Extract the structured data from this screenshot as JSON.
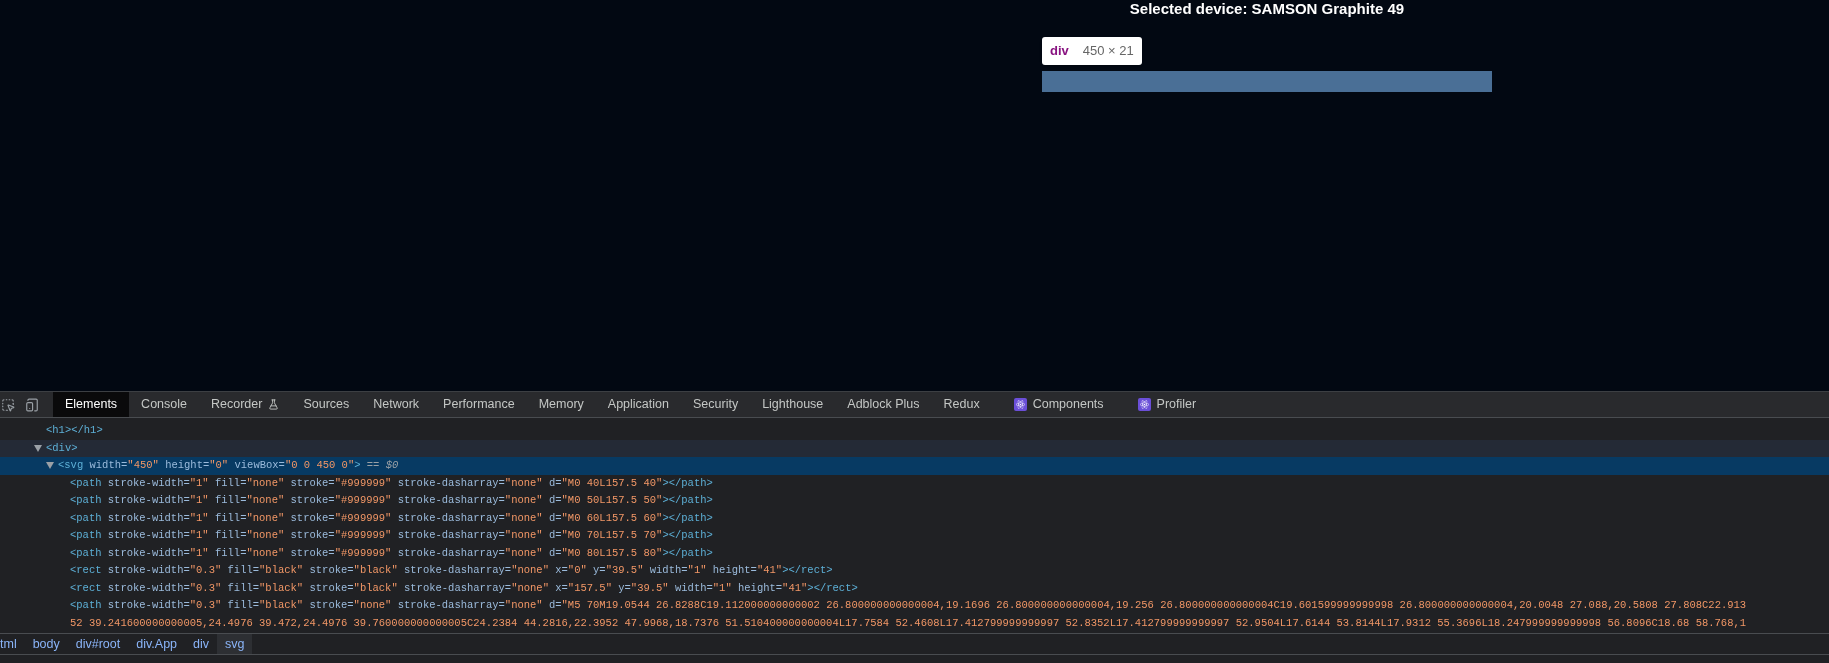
{
  "page": {
    "heading": "Selected device: SAMSON Graphite 49",
    "tooltip": {
      "tag": "div",
      "size": "450 × 21"
    }
  },
  "devtools": {
    "tabs": [
      {
        "label": "Elements",
        "selected": true
      },
      {
        "label": "Console",
        "selected": false
      },
      {
        "label": "Recorder",
        "selected": false,
        "kind": "flask"
      },
      {
        "label": "Sources",
        "selected": false
      },
      {
        "label": "Network",
        "selected": false
      },
      {
        "label": "Performance",
        "selected": false
      },
      {
        "label": "Memory",
        "selected": false
      },
      {
        "label": "Application",
        "selected": false
      },
      {
        "label": "Security",
        "selected": false
      },
      {
        "label": "Lighthouse",
        "selected": false
      },
      {
        "label": "Adblock Plus",
        "selected": false
      },
      {
        "label": "Redux",
        "selected": false
      },
      {
        "label": "Components",
        "selected": false,
        "kind": "react"
      },
      {
        "label": "Profiler",
        "selected": false,
        "kind": "react"
      }
    ],
    "dom_tree": [
      {
        "selected": false,
        "tokens": [
          {
            "kind": "tag",
            "text": "<h1></h1>"
          }
        ]
      },
      {
        "selected": false,
        "hovered": true,
        "expanded": true,
        "tokens": [
          {
            "kind": "tag",
            "text": "<div>"
          }
        ],
        "children": [
          {
            "selected": true,
            "expanded": true,
            "tokens": [
              {
                "kind": "tag",
                "text": "<svg"
              },
              {
                "kind": "attr",
                "text": " width="
              },
              {
                "kind": "value",
                "text": "\"450\""
              },
              {
                "kind": "attr",
                "text": " height="
              },
              {
                "kind": "value",
                "text": "\"0\""
              },
              {
                "kind": "attr",
                "text": " viewBox="
              },
              {
                "kind": "value",
                "text": "\"0 0 450 0\""
              },
              {
                "kind": "tag",
                "text": ">"
              },
              {
                "kind": "ref",
                "text": " == $0"
              }
            ],
            "children": [
              {
                "selected": false,
                "tokens": [
                  {
                    "kind": "tag",
                    "text": "<path"
                  },
                  {
                    "kind": "attr",
                    "text": " stroke-width="
                  },
                  {
                    "kind": "value",
                    "text": "\"1\""
                  },
                  {
                    "kind": "attr",
                    "text": " fill="
                  },
                  {
                    "kind": "value",
                    "text": "\"none\""
                  },
                  {
                    "kind": "attr",
                    "text": " stroke="
                  },
                  {
                    "kind": "value",
                    "text": "\"#999999\""
                  },
                  {
                    "kind": "attr",
                    "text": " stroke-dasharray="
                  },
                  {
                    "kind": "value",
                    "text": "\"none\""
                  },
                  {
                    "kind": "attr",
                    "text": " d="
                  },
                  {
                    "kind": "value",
                    "text": "\"M0 40L157.5 40\""
                  },
                  {
                    "kind": "tag",
                    "text": "></path>"
                  }
                ]
              },
              {
                "selected": false,
                "tokens": [
                  {
                    "kind": "tag",
                    "text": "<path"
                  },
                  {
                    "kind": "attr",
                    "text": " stroke-width="
                  },
                  {
                    "kind": "value",
                    "text": "\"1\""
                  },
                  {
                    "kind": "attr",
                    "text": " fill="
                  },
                  {
                    "kind": "value",
                    "text": "\"none\""
                  },
                  {
                    "kind": "attr",
                    "text": " stroke="
                  },
                  {
                    "kind": "value",
                    "text": "\"#999999\""
                  },
                  {
                    "kind": "attr",
                    "text": " stroke-dasharray="
                  },
                  {
                    "kind": "value",
                    "text": "\"none\""
                  },
                  {
                    "kind": "attr",
                    "text": " d="
                  },
                  {
                    "kind": "value",
                    "text": "\"M0 50L157.5 50\""
                  },
                  {
                    "kind": "tag",
                    "text": "></path>"
                  }
                ]
              },
              {
                "selected": false,
                "tokens": [
                  {
                    "kind": "tag",
                    "text": "<path"
                  },
                  {
                    "kind": "attr",
                    "text": " stroke-width="
                  },
                  {
                    "kind": "value",
                    "text": "\"1\""
                  },
                  {
                    "kind": "attr",
                    "text": " fill="
                  },
                  {
                    "kind": "value",
                    "text": "\"none\""
                  },
                  {
                    "kind": "attr",
                    "text": " stroke="
                  },
                  {
                    "kind": "value",
                    "text": "\"#999999\""
                  },
                  {
                    "kind": "attr",
                    "text": " stroke-dasharray="
                  },
                  {
                    "kind": "value",
                    "text": "\"none\""
                  },
                  {
                    "kind": "attr",
                    "text": " d="
                  },
                  {
                    "kind": "value",
                    "text": "\"M0 60L157.5 60\""
                  },
                  {
                    "kind": "tag",
                    "text": "></path>"
                  }
                ]
              },
              {
                "selected": false,
                "tokens": [
                  {
                    "kind": "tag",
                    "text": "<path"
                  },
                  {
                    "kind": "attr",
                    "text": " stroke-width="
                  },
                  {
                    "kind": "value",
                    "text": "\"1\""
                  },
                  {
                    "kind": "attr",
                    "text": " fill="
                  },
                  {
                    "kind": "value",
                    "text": "\"none\""
                  },
                  {
                    "kind": "attr",
                    "text": " stroke="
                  },
                  {
                    "kind": "value",
                    "text": "\"#999999\""
                  },
                  {
                    "kind": "attr",
                    "text": " stroke-dasharray="
                  },
                  {
                    "kind": "value",
                    "text": "\"none\""
                  },
                  {
                    "kind": "attr",
                    "text": " d="
                  },
                  {
                    "kind": "value",
                    "text": "\"M0 70L157.5 70\""
                  },
                  {
                    "kind": "tag",
                    "text": "></path>"
                  }
                ]
              },
              {
                "selected": false,
                "tokens": [
                  {
                    "kind": "tag",
                    "text": "<path"
                  },
                  {
                    "kind": "attr",
                    "text": " stroke-width="
                  },
                  {
                    "kind": "value",
                    "text": "\"1\""
                  },
                  {
                    "kind": "attr",
                    "text": " fill="
                  },
                  {
                    "kind": "value",
                    "text": "\"none\""
                  },
                  {
                    "kind": "attr",
                    "text": " stroke="
                  },
                  {
                    "kind": "value",
                    "text": "\"#999999\""
                  },
                  {
                    "kind": "attr",
                    "text": " stroke-dasharray="
                  },
                  {
                    "kind": "value",
                    "text": "\"none\""
                  },
                  {
                    "kind": "attr",
                    "text": " d="
                  },
                  {
                    "kind": "value",
                    "text": "\"M0 80L157.5 80\""
                  },
                  {
                    "kind": "tag",
                    "text": "></path>"
                  }
                ]
              },
              {
                "selected": false,
                "tokens": [
                  {
                    "kind": "tag",
                    "text": "<rect"
                  },
                  {
                    "kind": "attr",
                    "text": " stroke-width="
                  },
                  {
                    "kind": "value",
                    "text": "\"0.3\""
                  },
                  {
                    "kind": "attr",
                    "text": " fill="
                  },
                  {
                    "kind": "value",
                    "text": "\"black\""
                  },
                  {
                    "kind": "attr",
                    "text": " stroke="
                  },
                  {
                    "kind": "value",
                    "text": "\"black\""
                  },
                  {
                    "kind": "attr",
                    "text": " stroke-dasharray="
                  },
                  {
                    "kind": "value",
                    "text": "\"none\""
                  },
                  {
                    "kind": "attr",
                    "text": " x="
                  },
                  {
                    "kind": "value",
                    "text": "\"0\""
                  },
                  {
                    "kind": "attr",
                    "text": " y="
                  },
                  {
                    "kind": "value",
                    "text": "\"39.5\""
                  },
                  {
                    "kind": "attr",
                    "text": " width="
                  },
                  {
                    "kind": "value",
                    "text": "\"1\""
                  },
                  {
                    "kind": "attr",
                    "text": " height="
                  },
                  {
                    "kind": "value",
                    "text": "\"41\""
                  },
                  {
                    "kind": "tag",
                    "text": "></rect>"
                  }
                ]
              },
              {
                "selected": false,
                "tokens": [
                  {
                    "kind": "tag",
                    "text": "<rect"
                  },
                  {
                    "kind": "attr",
                    "text": " stroke-width="
                  },
                  {
                    "kind": "value",
                    "text": "\"0.3\""
                  },
                  {
                    "kind": "attr",
                    "text": " fill="
                  },
                  {
                    "kind": "value",
                    "text": "\"black\""
                  },
                  {
                    "kind": "attr",
                    "text": " stroke="
                  },
                  {
                    "kind": "value",
                    "text": "\"black\""
                  },
                  {
                    "kind": "attr",
                    "text": " stroke-dasharray="
                  },
                  {
                    "kind": "value",
                    "text": "\"none\""
                  },
                  {
                    "kind": "attr",
                    "text": " x="
                  },
                  {
                    "kind": "value",
                    "text": "\"157.5\""
                  },
                  {
                    "kind": "attr",
                    "text": " y="
                  },
                  {
                    "kind": "value",
                    "text": "\"39.5\""
                  },
                  {
                    "kind": "attr",
                    "text": " width="
                  },
                  {
                    "kind": "value",
                    "text": "\"1\""
                  },
                  {
                    "kind": "attr",
                    "text": " height="
                  },
                  {
                    "kind": "value",
                    "text": "\"41\""
                  },
                  {
                    "kind": "tag",
                    "text": "></rect>"
                  }
                ]
              },
              {
                "selected": false,
                "tokens": [
                  {
                    "kind": "tag",
                    "text": "<path"
                  },
                  {
                    "kind": "attr",
                    "text": " stroke-width="
                  },
                  {
                    "kind": "value",
                    "text": "\"0.3\""
                  },
                  {
                    "kind": "attr",
                    "text": " fill="
                  },
                  {
                    "kind": "value",
                    "text": "\"black\""
                  },
                  {
                    "kind": "attr",
                    "text": " stroke="
                  },
                  {
                    "kind": "value",
                    "text": "\"none\""
                  },
                  {
                    "kind": "attr",
                    "text": " stroke-dasharray="
                  },
                  {
                    "kind": "value",
                    "text": "\"none\""
                  },
                  {
                    "kind": "attr",
                    "text": " d="
                  },
                  {
                    "kind": "value",
                    "text": "\"M5 70M19.0544 26.8288C19.112000000000002 26.800000000000004,19.1696 26.800000000000004,19.256 26.800000000000004C19.601599999999998 26.800000000000004,20.0048 27.088,20.5808 27.808C22.913"
                  }
                ],
                "continued": "52 39.241600000000005,24.4976 39.472,24.4976 39.760000000000005C24.2384 44.2816,22.3952 47.9968,18.7376 51.510400000000004L17.7584 52.4608L17.412799999999997 52.8352L17.412799999999997 52.9504L17.6144 53.8144L17.9312 55.3696L18.247999999999998 56.8096C18.68 58.768,1"
              }
            ]
          }
        ]
      }
    ],
    "breadcrumbs": [
      {
        "label": "tml",
        "selected": false
      },
      {
        "label": "body",
        "selected": false
      },
      {
        "label": "div#root",
        "selected": false
      },
      {
        "label": "div.App",
        "selected": false
      },
      {
        "label": "div",
        "selected": false
      },
      {
        "label": "svg",
        "selected": true
      }
    ]
  }
}
